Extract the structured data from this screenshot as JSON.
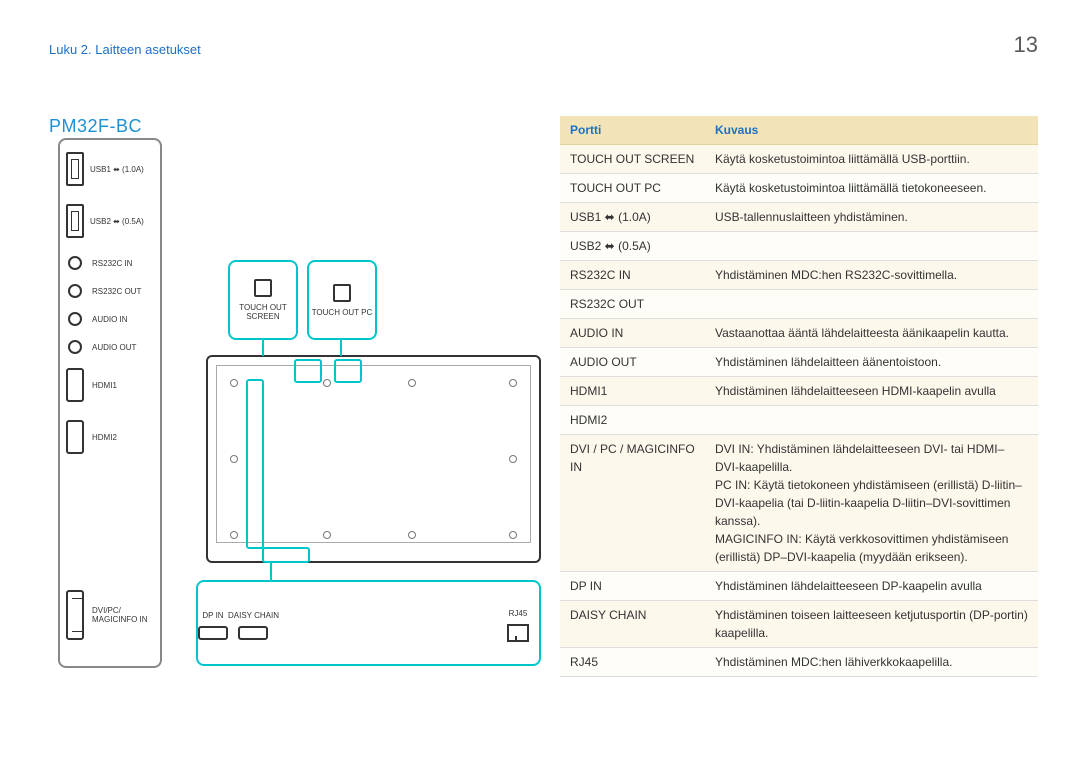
{
  "page": {
    "chapter": "Luku 2. Laitteen asetukset",
    "number": "13",
    "model": "PM32F-BC"
  },
  "side_ports": {
    "usb1": "USB1 ⬌\n(1.0A)",
    "usb2": "USB2 ⬌\n(0.5A)",
    "rs_in": "RS232C\nIN",
    "rs_out": "RS232C\nOUT",
    "audio_in": "AUDIO\nIN",
    "audio_out": "AUDIO\nOUT",
    "hdmi1": "HDMI1",
    "hdmi2": "HDMI2",
    "dvi": "DVI/PC/\nMAGICINFO IN"
  },
  "touch_boxes": {
    "screen": "TOUCH OUT\nSCREEN",
    "pc": "TOUCH OUT\nPC"
  },
  "bottom_ports": {
    "dpin": "DP IN",
    "daisy": "DAISY CHAIN",
    "rj45": "RJ45"
  },
  "table": {
    "headers": {
      "port": "Portti",
      "desc": "Kuvaus"
    },
    "rows": [
      {
        "port": "TOUCH OUT SCREEN",
        "desc": "Käytä kosketustoimintoa liittämällä USB-porttiin."
      },
      {
        "port": "TOUCH OUT PC",
        "desc": "Käytä kosketustoimintoa liittämällä tietokoneeseen."
      },
      {
        "port": "USB1 ⬌ (1.0A)",
        "desc": "USB-tallennuslaitteen yhdistäminen."
      },
      {
        "port": "USB2 ⬌ (0.5A)",
        "desc": ""
      },
      {
        "port": "RS232C IN",
        "desc": "Yhdistäminen MDC:hen RS232C-sovittimella."
      },
      {
        "port": "RS232C OUT",
        "desc": ""
      },
      {
        "port": "AUDIO IN",
        "desc": "Vastaanottaa ääntä lähdelaitteesta äänikaapelin kautta."
      },
      {
        "port": "AUDIO OUT",
        "desc": "Yhdistäminen lähdelaitteen äänentoistoon."
      },
      {
        "port": "HDMI1",
        "desc": "Yhdistäminen lähdelaitteeseen HDMI-kaapelin avulla"
      },
      {
        "port": "HDMI2",
        "desc": ""
      },
      {
        "port": "DVI / PC / MAGICINFO IN",
        "desc": "DVI IN: Yhdistäminen lähdelaitteeseen DVI- tai HDMI–DVI-kaapelilla.\nPC IN: Käytä tietokoneen yhdistämiseen (erillistä) D-liitin–DVI-kaapelia (tai D-liitin-kaapelia D-liitin–DVI-sovittimen kanssa).\nMAGICINFO IN: Käytä verkkosovittimen yhdistämiseen (erillistä) DP–DVI-kaapelia (myydään erikseen)."
      },
      {
        "port": "DP IN",
        "desc": "Yhdistäminen lähdelaitteeseen DP-kaapelin avulla"
      },
      {
        "port": "DAISY CHAIN",
        "desc": "Yhdistäminen toiseen laitteeseen ketjutusportin (DP-portin) kaapelilla."
      },
      {
        "port": "RJ45",
        "desc": "Yhdistäminen MDC:hen lähiverkkokaapelilla."
      }
    ]
  }
}
